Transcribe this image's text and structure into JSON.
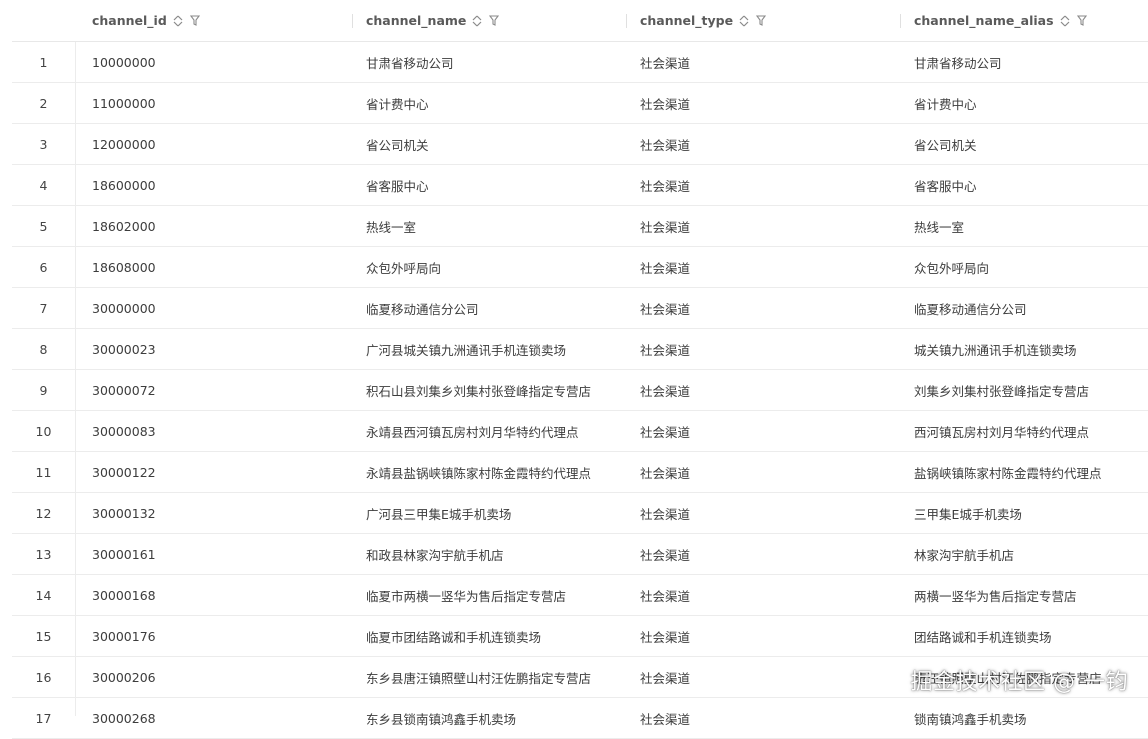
{
  "columns": [
    {
      "key": "channel_id",
      "label": "channel_id"
    },
    {
      "key": "channel_name",
      "label": "channel_name"
    },
    {
      "key": "channel_type",
      "label": "channel_type"
    },
    {
      "key": "channel_name_alias",
      "label": "channel_name_alias"
    }
  ],
  "icons": {
    "sort": "sort-icon",
    "filter": "filter-icon"
  },
  "rows": [
    {
      "num": "1",
      "channel_id": "10000000",
      "channel_name": "甘肃省移动公司",
      "channel_type": "社会渠道",
      "channel_name_alias": "甘肃省移动公司"
    },
    {
      "num": "2",
      "channel_id": "11000000",
      "channel_name": "省计费中心",
      "channel_type": "社会渠道",
      "channel_name_alias": "省计费中心"
    },
    {
      "num": "3",
      "channel_id": "12000000",
      "channel_name": "省公司机关",
      "channel_type": "社会渠道",
      "channel_name_alias": "省公司机关"
    },
    {
      "num": "4",
      "channel_id": "18600000",
      "channel_name": "省客服中心",
      "channel_type": "社会渠道",
      "channel_name_alias": "省客服中心"
    },
    {
      "num": "5",
      "channel_id": "18602000",
      "channel_name": "热线一室",
      "channel_type": "社会渠道",
      "channel_name_alias": "热线一室"
    },
    {
      "num": "6",
      "channel_id": "18608000",
      "channel_name": "众包外呼局向",
      "channel_type": "社会渠道",
      "channel_name_alias": "众包外呼局向"
    },
    {
      "num": "7",
      "channel_id": "30000000",
      "channel_name": "临夏移动通信分公司",
      "channel_type": "社会渠道",
      "channel_name_alias": "临夏移动通信分公司"
    },
    {
      "num": "8",
      "channel_id": "30000023",
      "channel_name": "广河县城关镇九洲通讯手机连锁卖场",
      "channel_type": "社会渠道",
      "channel_name_alias": "城关镇九洲通讯手机连锁卖场"
    },
    {
      "num": "9",
      "channel_id": "30000072",
      "channel_name": "积石山县刘集乡刘集村张登峰指定专营店",
      "channel_type": "社会渠道",
      "channel_name_alias": "刘集乡刘集村张登峰指定专营店"
    },
    {
      "num": "10",
      "channel_id": "30000083",
      "channel_name": "永靖县西河镇瓦房村刘月华特约代理点",
      "channel_type": "社会渠道",
      "channel_name_alias": "西河镇瓦房村刘月华特约代理点"
    },
    {
      "num": "11",
      "channel_id": "30000122",
      "channel_name": "永靖县盐锅峡镇陈家村陈金霞特约代理点",
      "channel_type": "社会渠道",
      "channel_name_alias": "盐锅峡镇陈家村陈金霞特约代理点"
    },
    {
      "num": "12",
      "channel_id": "30000132",
      "channel_name": "广河县三甲集E城手机卖场",
      "channel_type": "社会渠道",
      "channel_name_alias": "三甲集E城手机卖场"
    },
    {
      "num": "13",
      "channel_id": "30000161",
      "channel_name": "和政县林家沟宇航手机店",
      "channel_type": "社会渠道",
      "channel_name_alias": "林家沟宇航手机店"
    },
    {
      "num": "14",
      "channel_id": "30000168",
      "channel_name": "临夏市两横一竖华为售后指定专营店",
      "channel_type": "社会渠道",
      "channel_name_alias": "两横一竖华为售后指定专营店"
    },
    {
      "num": "15",
      "channel_id": "30000176",
      "channel_name": "临夏市团结路诚和手机连锁卖场",
      "channel_type": "社会渠道",
      "channel_name_alias": "团结路诚和手机连锁卖场"
    },
    {
      "num": "16",
      "channel_id": "30000206",
      "channel_name": "东乡县唐汪镇照壁山村汪佐鹏指定专营店",
      "channel_type": "社会渠道",
      "channel_name_alias": "唐汪镇照壁山村汪佐鹏指定专营店"
    },
    {
      "num": "17",
      "channel_id": "30000268",
      "channel_name": "东乡县锁南镇鸿鑫手机卖场",
      "channel_type": "社会渠道",
      "channel_name_alias": "锁南镇鸿鑫手机卖场"
    }
  ],
  "watermark": "掘金技术社区 @ 一钧"
}
